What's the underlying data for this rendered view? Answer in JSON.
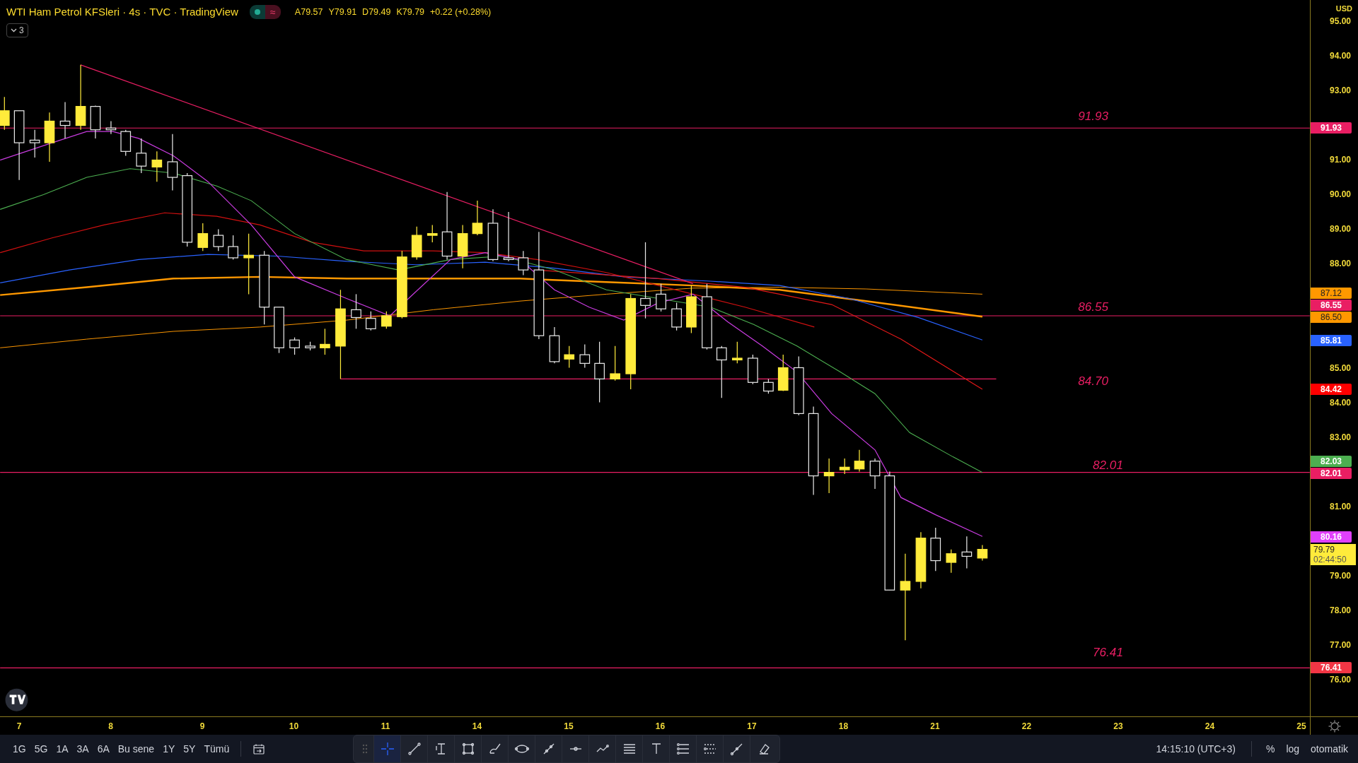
{
  "header": {
    "title": "WTI Ham Petrol KFSleri · 4s · TVC · TradingView",
    "status_symbol": "≈",
    "ohlc": [
      "A79.57",
      "Y79.91",
      "D79.49",
      "K79.79",
      "+0.22 (+0.28%)"
    ],
    "indicator_count": "3"
  },
  "chart": {
    "level_labels": [
      "91.93",
      "86.55",
      "84.70",
      "82.01",
      "76.41"
    ]
  },
  "price_axis": {
    "currency": "USD",
    "labels": [
      "95.00",
      "94.00",
      "93.00",
      "91.00",
      "90.00",
      "89.00",
      "88.00",
      "85.00",
      "84.00",
      "83.00",
      "81.00",
      "79.00",
      "78.00",
      "77.00",
      "76.00"
    ],
    "tags": [
      {
        "value": "91.93",
        "color": "#e91e63"
      },
      {
        "value": "87.12",
        "color": "#ff9800"
      },
      {
        "value": "86.55",
        "color": "#e91e63"
      },
      {
        "value": "86.50",
        "color": "#ff9800"
      },
      {
        "value": "85.81",
        "color": "#2962ff"
      },
      {
        "value": "84.42",
        "color": "#ff0000"
      },
      {
        "value": "82.03",
        "color": "#4caf50"
      },
      {
        "value": "82.01",
        "color": "#e91e63"
      },
      {
        "value": "80.16",
        "color": "#e040fb"
      },
      {
        "value": "76.41",
        "color": "#f23645"
      }
    ],
    "last_price": {
      "value": "79.79",
      "countdown": "02:44:50"
    }
  },
  "time_axis": {
    "labels": [
      "7",
      "8",
      "9",
      "10",
      "11",
      "14",
      "15",
      "16",
      "17",
      "18",
      "21",
      "22",
      "23",
      "24",
      "25"
    ]
  },
  "bottom_bar": {
    "ranges": [
      "1G",
      "5G",
      "1A",
      "3A",
      "6A",
      "Bu sene",
      "1Y",
      "5Y",
      "Tümü"
    ],
    "drawing_tools": [
      {
        "kind": "crosshair",
        "selected": true
      },
      {
        "kind": "line",
        "selected": false
      },
      {
        "kind": "ibeam",
        "selected": false
      },
      {
        "kind": "rect",
        "selected": false
      },
      {
        "kind": "brush",
        "selected": false
      },
      {
        "kind": "ellipse",
        "selected": false
      },
      {
        "kind": "path",
        "selected": false
      },
      {
        "kind": "hline",
        "selected": false
      },
      {
        "kind": "polyline",
        "selected": false
      },
      {
        "kind": "lines",
        "selected": false
      },
      {
        "kind": "text",
        "selected": false
      },
      {
        "kind": "list",
        "selected": false
      },
      {
        "kind": "list2",
        "selected": false
      },
      {
        "kind": "pen",
        "selected": false
      },
      {
        "kind": "eraser",
        "selected": false
      }
    ],
    "time": "14:15:10 (UTC+3)",
    "options": [
      "%",
      "log",
      "otomatik"
    ]
  }
}
